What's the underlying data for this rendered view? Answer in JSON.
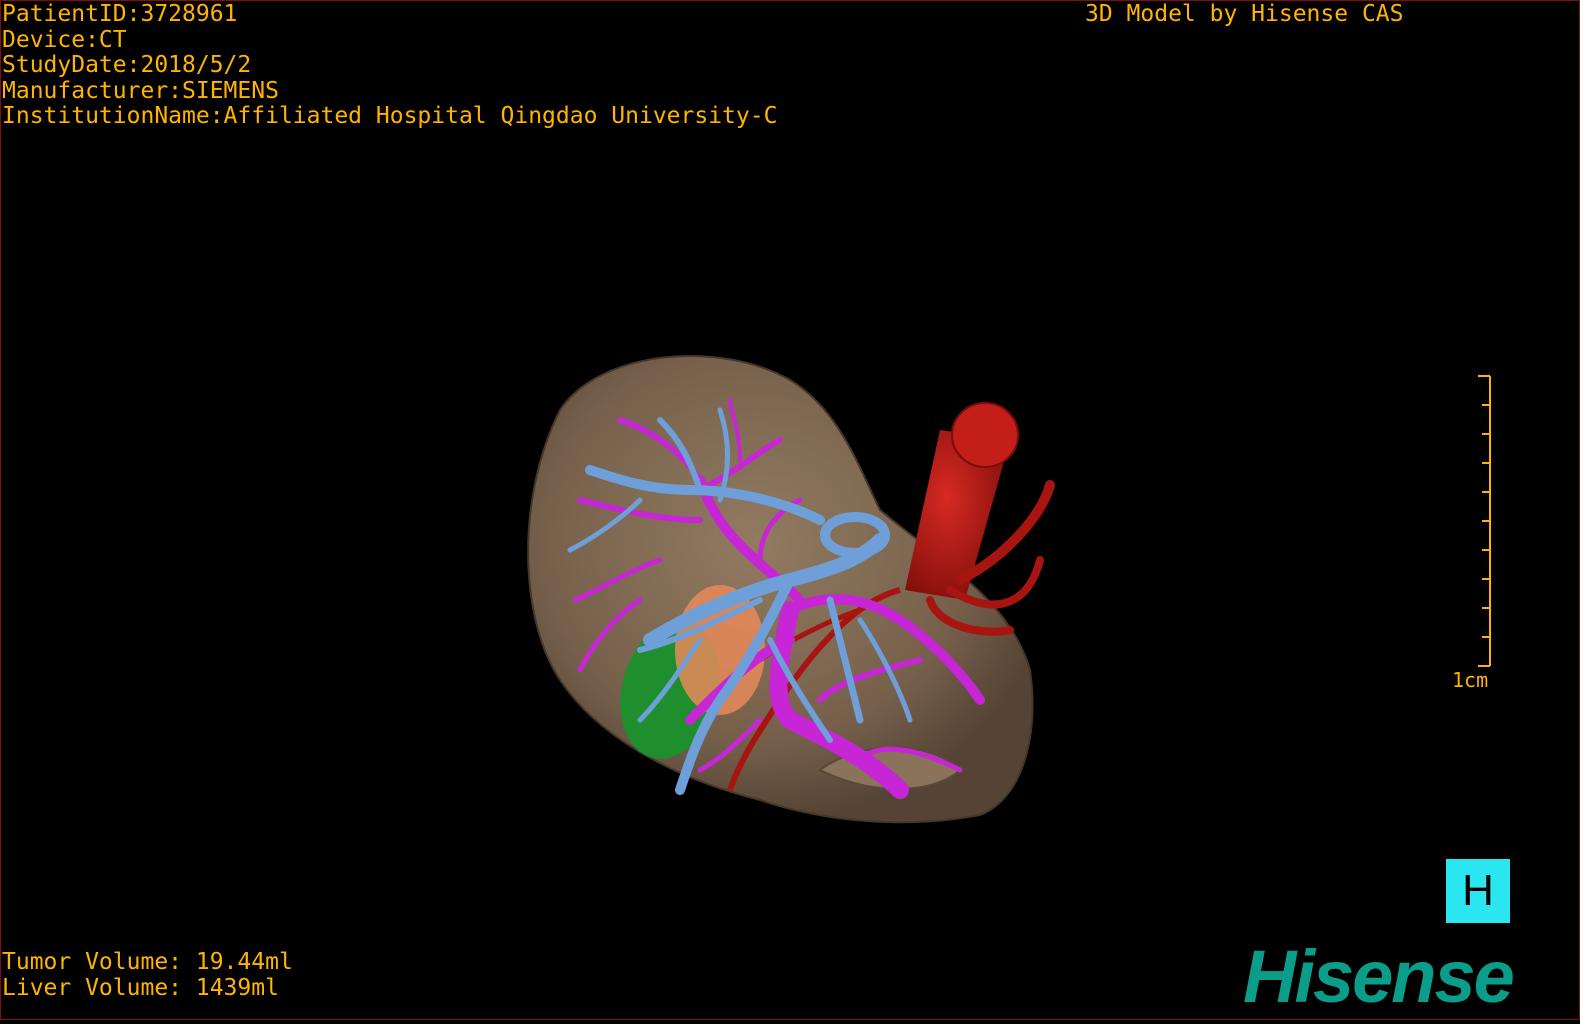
{
  "header": {
    "patient_id": "PatientID:3728961",
    "device": "Device:CT",
    "study_date": "StudyDate:2018/5/2",
    "manufacturer": "Manufacturer:SIEMENS",
    "institution": "InstitutionName:Affiliated Hospital Qingdao University-C"
  },
  "brand_top": "3D Model by Hisense CAS",
  "volumes": {
    "tumor": "Tumor Volume: 19.44ml",
    "liver": "Liver Volume: 1439ml"
  },
  "scale": {
    "label": "1cm"
  },
  "home_button": {
    "label": "H"
  },
  "logo": {
    "text": "Hisense"
  },
  "colors": {
    "overlay_text": "#ffb400",
    "liver": "#8c7459",
    "portal_vein": "#c626d6",
    "hepatic_vein": "#6f9fd8",
    "artery": "#b01a14",
    "tumor": "#1f8f2e",
    "tumor_inner": "#e8895a",
    "home_button": "#29e6f0",
    "logo": "#0a9e8a"
  }
}
